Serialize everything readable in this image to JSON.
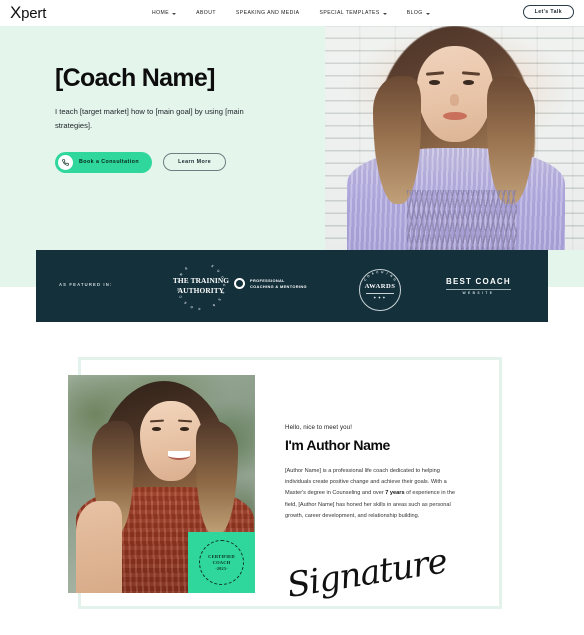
{
  "header": {
    "logo": "Xpert",
    "logo_initial": "X",
    "logo_rest": "pert",
    "nav": [
      {
        "label": "HOME",
        "has_dropdown": true
      },
      {
        "label": "ABOUT",
        "has_dropdown": false
      },
      {
        "label": "SPEAKING AND MEDIA",
        "has_dropdown": false
      },
      {
        "label": "SPECIAL TEMPLATES",
        "has_dropdown": true
      },
      {
        "label": "BLOG",
        "has_dropdown": true
      }
    ],
    "cta_label": "Let's Talk"
  },
  "hero": {
    "title": "[Coach Name]",
    "subtitle": "I teach [target market] how to [main goal] by using [main strategies].",
    "primary_button": "Book a Consultation",
    "primary_button_icon": "phone-icon",
    "secondary_button": "Learn More",
    "image_alt": "woman in lavender sweater holding lavender flowers",
    "background_color": "#e4f5ec",
    "accent_color": "#2fd79d"
  },
  "featured": {
    "label": "AS FEATURED IN:",
    "background_color": "#14303b",
    "logos": [
      {
        "name": "the-training-authority",
        "line1": "THE TRAINING",
        "line2": "AUTHORITY",
        "ring_text": "SUCCESS COACHING"
      },
      {
        "name": "professional-coaching-mentoring",
        "line1": "PROFESSIONAL",
        "line2": "COACHING & MENTORING"
      },
      {
        "name": "coaching-awards",
        "ring_text": "COACHING",
        "word": "AWARDS",
        "stars": "✦✦✦"
      },
      {
        "name": "best-coach-website",
        "line1": "BEST COACH",
        "line2": "WEBSITE"
      }
    ]
  },
  "about": {
    "greeting": "Hello, nice to meet you!",
    "heading": "I'm Author Name",
    "body_1": "[Author Name] is a professional life coach dedicated to helping individuals create positive change and achieve their goals. With a Master's degree in Counseling and over ",
    "body_highlight": "7 years",
    "body_2": " of experience in the field, [Author Name] has honed her skills in areas such as personal growth, career development, and relationship building.",
    "signature": "Signature",
    "image_alt": "smiling woman in rust sweater",
    "badge": {
      "line1": "CERTIFIED",
      "line2": "COACH",
      "line3": "-2023-",
      "background_color": "#2fd79d"
    },
    "frame_color": "#e3f3ec"
  }
}
